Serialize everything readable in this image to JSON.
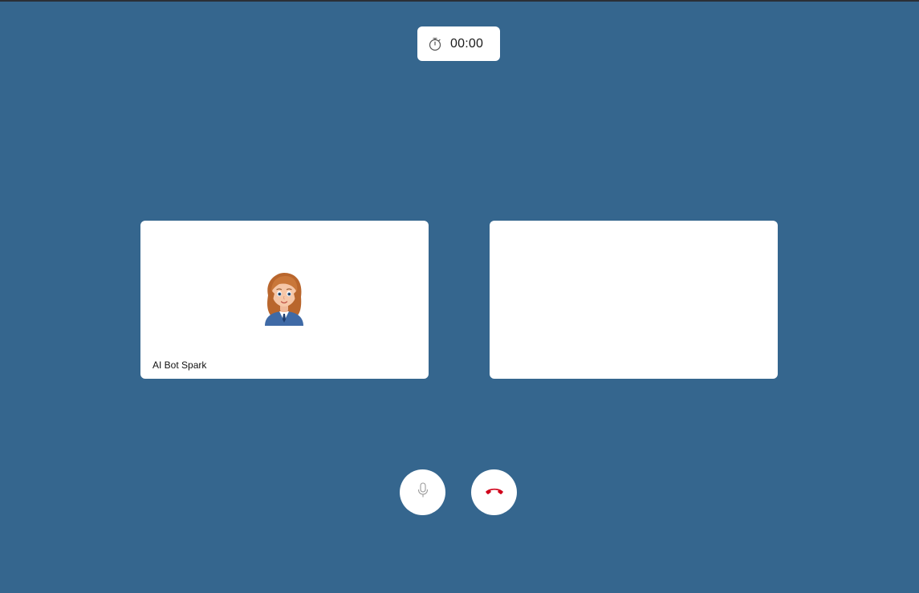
{
  "timer": {
    "icon": "stopwatch-icon",
    "value": "00:00"
  },
  "participants": [
    {
      "name": "AI Bot Spark",
      "avatar": "cartoon-woman-avatar"
    },
    {
      "name": ""
    }
  ],
  "controls": {
    "mic": {
      "icon": "microphone-icon"
    },
    "hangup": {
      "icon": "phone-hangup-icon",
      "color": "#d0021b"
    }
  },
  "colors": {
    "background": "#35668e",
    "panel": "#ffffff"
  }
}
